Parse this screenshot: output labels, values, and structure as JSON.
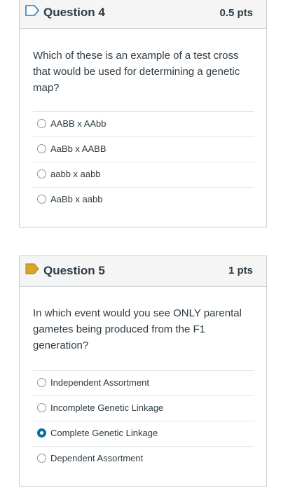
{
  "questions": [
    {
      "title": "Question 4",
      "points": "0.5 pts",
      "flag_icon": "flag-outline-icon",
      "flag_color": "#2b7abc",
      "text": "Which of these is an example of a test cross that would be used for determining a genetic map?",
      "answers": [
        {
          "label": "AABB x AAbb",
          "selected": false
        },
        {
          "label": "AaBb x AABB",
          "selected": false
        },
        {
          "label": "aabb x aabb",
          "selected": false
        },
        {
          "label": "AaBb x aabb",
          "selected": false
        }
      ]
    },
    {
      "title": "Question 5",
      "points": "1 pts",
      "flag_icon": "flag-filled-icon",
      "flag_color": "#d6a52a",
      "text": "In which event would you see ONLY parental gametes being produced from the F1 generation?",
      "answers": [
        {
          "label": "Independent Assortment",
          "selected": false
        },
        {
          "label": "Incomplete Genetic Linkage",
          "selected": false
        },
        {
          "label": "Complete Genetic Linkage",
          "selected": true
        },
        {
          "label": "Dependent Assortment",
          "selected": false
        }
      ]
    }
  ],
  "colors": {
    "accent": "#0770a3",
    "header_bg": "#f5f5f5",
    "border": "#c7cdd1"
  }
}
